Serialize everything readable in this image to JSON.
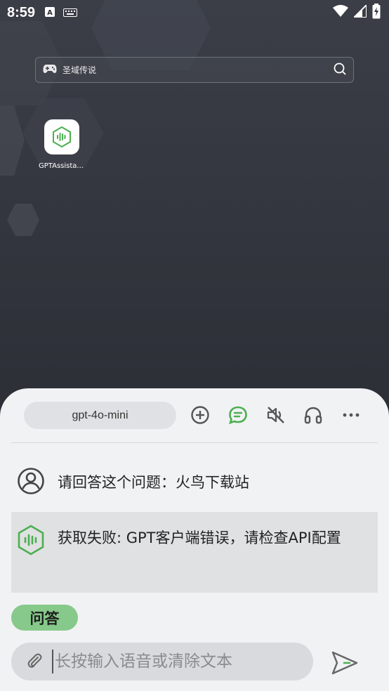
{
  "status_bar": {
    "time": "8:59",
    "icons_left": [
      "a-letter-icon",
      "keyboard-icon"
    ],
    "icons_right": [
      "wifi-icon",
      "signal-icon",
      "battery-icon"
    ]
  },
  "search": {
    "placeholder": "圣域传说",
    "left_icon": "gamepad-icon",
    "right_icon": "search-icon"
  },
  "home_apps": [
    {
      "label": "GPTAssista...",
      "icon": "voice-wave-icon"
    }
  ],
  "assistant_panel": {
    "model": "gpt-4o-mini",
    "toolbar_icons": [
      "add-circle-icon",
      "chat-bubble-icon",
      "volume-mute-icon",
      "headphones-icon",
      "more-icon"
    ],
    "messages": [
      {
        "role": "user",
        "icon": "user-avatar-icon",
        "text": "请回答这个问题：火鸟下载站"
      },
      {
        "role": "assistant",
        "icon": "hex-voice-icon",
        "text": "获取失败: GPT客户端错误，请检查API配置"
      }
    ],
    "mode_tag": "问答",
    "input": {
      "placeholder": "长按输入语音或清除文本",
      "value": ""
    },
    "attach_icon": "paperclip-icon",
    "send_icon": "send-icon"
  },
  "colors": {
    "accent_green": "#4caf50",
    "chip_green": "#86c98a",
    "background_dark": "#2e3038",
    "sheet_bg": "#f1f2f4"
  }
}
